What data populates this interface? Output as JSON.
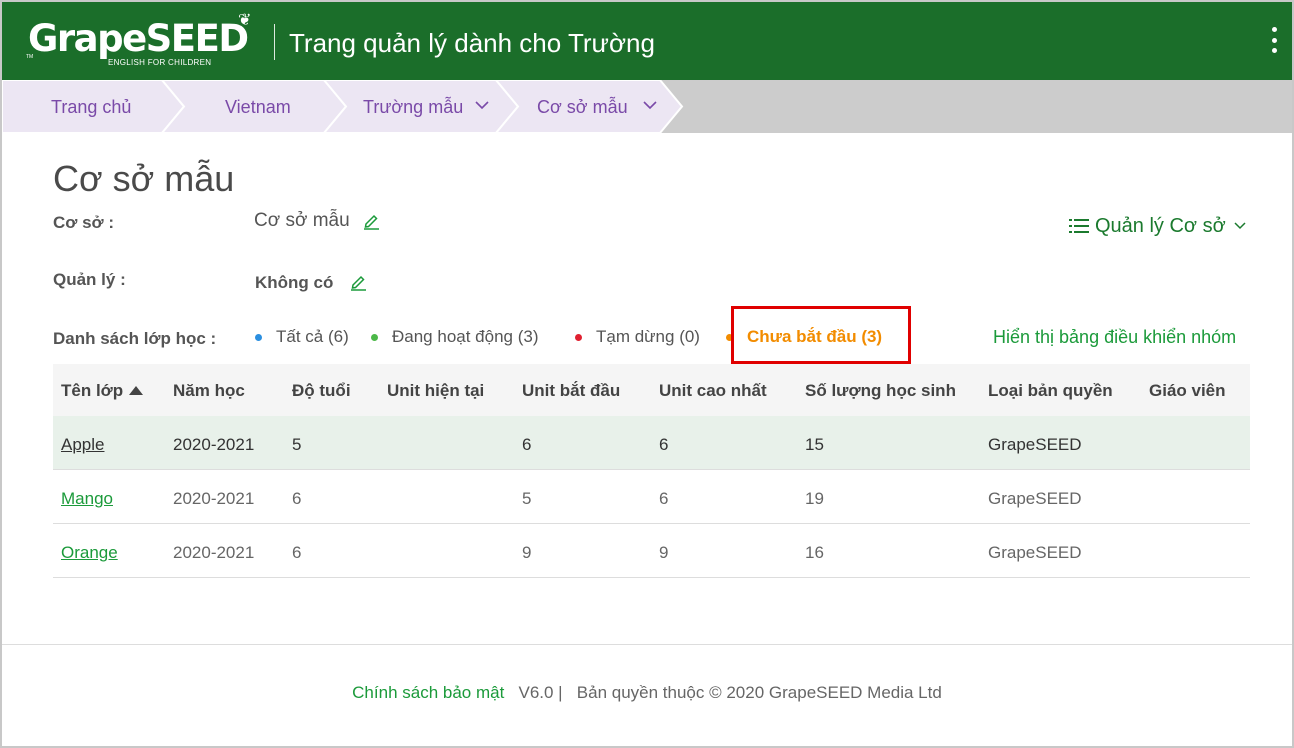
{
  "header": {
    "logo_text": "GrapeSEED",
    "logo_subtitle": "ENGLISH FOR CHILDREN",
    "title": "Trang quản lý dành cho Trường"
  },
  "breadcrumb": [
    {
      "label": "Trang chủ",
      "has_dropdown": false
    },
    {
      "label": "Vietnam",
      "has_dropdown": false
    },
    {
      "label": "Trường mẫu",
      "has_dropdown": true
    },
    {
      "label": "Cơ sở mẫu",
      "has_dropdown": true
    }
  ],
  "page": {
    "title": "Cơ sở mẫu",
    "campus_label": "Cơ sở :",
    "campus_value": "Cơ sở mẫu",
    "manager_label": "Quản lý :",
    "manager_value": "Không có",
    "manage_menu_label": "Quản lý Cơ sở"
  },
  "class_filter": {
    "label": "Danh sách lớp học :",
    "options": [
      {
        "label": "Tất cả (6)",
        "color": "#2b8fe0",
        "active": false
      },
      {
        "label": "Đang hoạt động (3)",
        "color": "#4cb848",
        "active": false
      },
      {
        "label": "Tạm dừng (0)",
        "color": "#e02030",
        "active": false
      },
      {
        "label": "Chưa bắt đầu (3)",
        "color": "#f28c00",
        "active": true
      }
    ],
    "dashboard_link": "Hiển thị bảng điều khiển nhóm"
  },
  "table": {
    "columns": [
      "Tên lớp",
      "Năm học",
      "Độ tuổi",
      "Unit hiện tại",
      "Unit bắt đầu",
      "Unit cao nhất",
      "Số lượng học sinh",
      "Loại bản quyền",
      "Giáo viên"
    ],
    "rows": [
      [
        "Apple",
        "2020-2021",
        "5",
        "",
        "6",
        "6",
        "15",
        "GrapeSEED",
        ""
      ],
      [
        "Mango",
        "2020-2021",
        "6",
        "",
        "5",
        "6",
        "19",
        "GrapeSEED",
        ""
      ],
      [
        "Orange",
        "2020-2021",
        "6",
        "",
        "9",
        "9",
        "16",
        "GrapeSEED",
        ""
      ]
    ]
  },
  "footer": {
    "privacy_link": "Chính sách bảo mật",
    "version": "V6.0 |",
    "copyright": "Bản quyền thuộc © 2020 GrapeSEED Media Ltd"
  },
  "colors": {
    "header_bg": "#1b6e2a",
    "breadcrumb_active_bg": "#ece6f3",
    "link_green": "#1b9a3a",
    "active_orange": "#f28c00",
    "highlight_red": "#e00000"
  }
}
